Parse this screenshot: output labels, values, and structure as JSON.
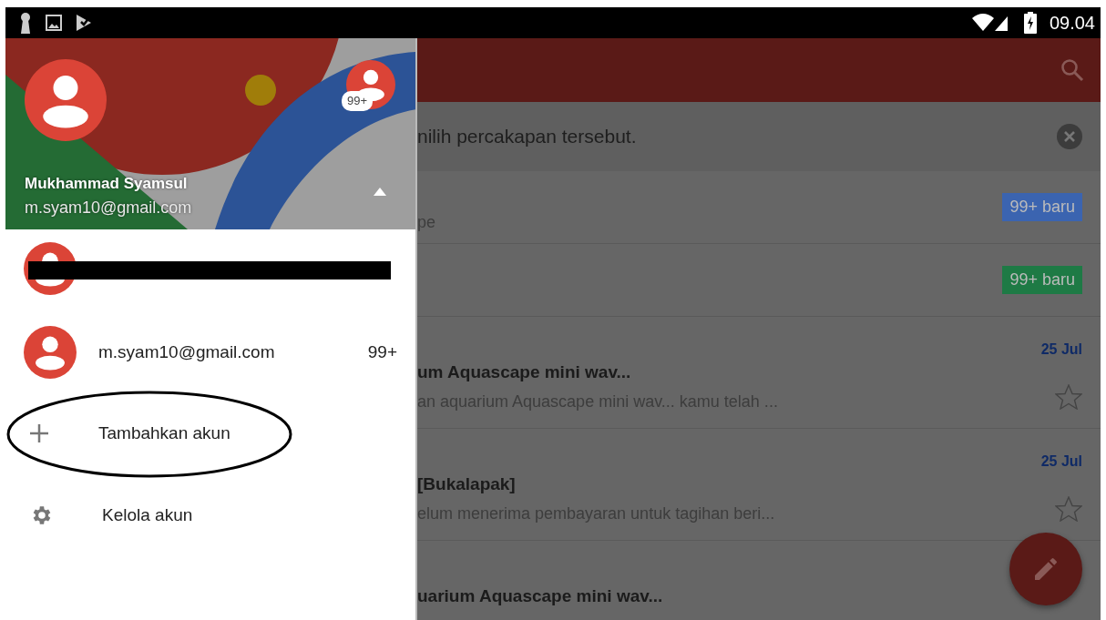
{
  "status_bar": {
    "time": "09.04"
  },
  "drawer": {
    "header": {
      "name": "Mukhammad Syamsul",
      "email": "m.syam10@gmail.com",
      "badge": "99+",
      "expanded": true
    },
    "accounts": [
      {
        "kind": "redacted"
      },
      {
        "kind": "account",
        "email": "m.syam10@gmail.com",
        "count": "99+"
      }
    ],
    "actions": [
      {
        "kind": "add",
        "label": "Tambahkan akun",
        "circled": true
      },
      {
        "kind": "manage",
        "label": "Kelola akun",
        "circled": false
      }
    ]
  },
  "inbox": {
    "banner": "nilih percakapan tersebut.",
    "rows": [
      {
        "kind": "label",
        "snippet": "pe",
        "badge": "99+ baru",
        "color": "#3b64b0"
      },
      {
        "kind": "label",
        "badge": "99+ baru",
        "color": "#1e7a45"
      },
      {
        "kind": "message",
        "date": "25 Jul",
        "subject": "um Aquascape mini wav...",
        "snippet": "an aquarium Aquascape mini wav... kamu telah ...",
        "starred": false
      },
      {
        "kind": "message",
        "date": "25 Jul",
        "subject": " [Bukalapak]",
        "snippet": "elum menerima pembayaran untuk tagihan beri...",
        "starred": false
      },
      {
        "kind": "message",
        "subject": "uarium Aquascape mini wav..."
      }
    ]
  }
}
